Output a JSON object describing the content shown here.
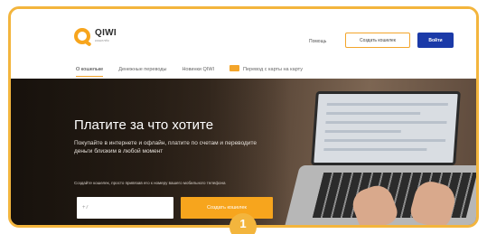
{
  "brand": {
    "name": "QIWI",
    "tagline": "кошелёк",
    "accent_color": "#f7a51d",
    "primary_color": "#1b3aa8",
    "frame_color": "#f3b53d"
  },
  "header": {
    "help_label": "Помощь",
    "create_wallet_label": "Создать кошелек",
    "login_label": "Войти"
  },
  "nav": {
    "items": [
      {
        "label": "О кошельке",
        "active": true
      },
      {
        "label": "Денежные переводы",
        "active": false
      },
      {
        "label": "Новинки QIWI",
        "active": false
      },
      {
        "label": "Перевод с карты на карту",
        "active": false,
        "icon": "card-icon"
      }
    ]
  },
  "hero": {
    "title": "Платите за что хотите",
    "description": "Покупайте в интернете и офлайн, платите по счетам и переводите деньги близким в любой момент",
    "hint": "Создайте кошелек, просто привязав его к номеру вашего мобильного телефона",
    "phone_placeholder": "+7",
    "create_button_label": "Создать кошелек"
  },
  "step_badge": "1"
}
